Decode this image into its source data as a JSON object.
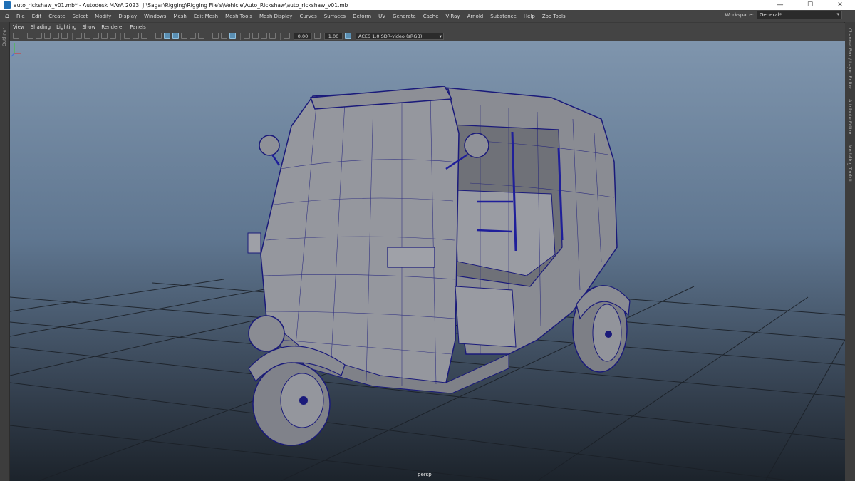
{
  "window": {
    "title": "auto_rickshaw_v01.mb* - Autodesk MAYA 2023: J:\\Sagar\\Rigging\\Rigging File's\\Vehicle\\Auto_Rickshaw\\auto_rickshaw_v01.mb",
    "minimize_glyph": "—",
    "maximize_glyph": "☐",
    "close_glyph": "✕"
  },
  "menubar": {
    "items": [
      "File",
      "Edit",
      "Create",
      "Select",
      "Modify",
      "Display",
      "Windows",
      "Mesh",
      "Edit Mesh",
      "Mesh Tools",
      "Mesh Display",
      "Curves",
      "Surfaces",
      "Deform",
      "UV",
      "Generate",
      "Cache",
      "V-Ray",
      "Arnold",
      "Substance",
      "Help",
      "Zoo Tools"
    ],
    "workspace_label": "Workspace:",
    "workspace_value": "General*"
  },
  "left_panel": {
    "tab": "Outliner"
  },
  "right_panel": {
    "tabs": [
      "Channel Box / Layer Editor",
      "Attribute Editor",
      "Modeling Toolkit"
    ]
  },
  "viewport": {
    "panel_menu": [
      "View",
      "Shading",
      "Lighting",
      "Show",
      "Renderer",
      "Panels"
    ],
    "exposure": "0.00",
    "gamma": "1.00",
    "color_space": "ACES 1.0 SDR-video (sRGB)",
    "camera": "persp"
  },
  "colors": {
    "wire": "#1a1a7a",
    "mesh_fill": "#8e9097",
    "grid": "#1b2027"
  }
}
